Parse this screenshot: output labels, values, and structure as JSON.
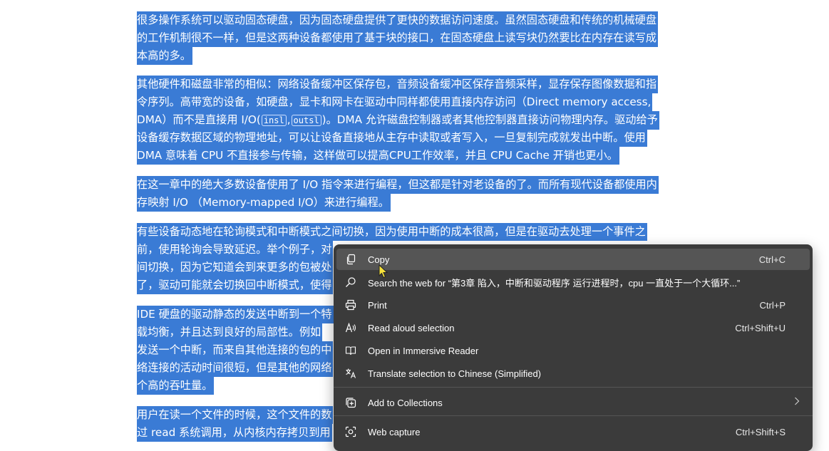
{
  "paragraphs": [
    {
      "lines": [
        [
          "很多操作系统可以驱动固态硬盘，因为固态硬盘提供了更快的数据访问速度。虽然固态硬盘和传统的机械硬盘"
        ],
        [
          "的工作机制很不一样，但是这两种设备都使用了基于块的接口，在固态硬盘上读写块仍然要比在内存在读写成"
        ],
        [
          "本高的多。"
        ]
      ]
    },
    {
      "lines": [
        [
          "其他硬件和磁盘非常的相似：网络设备缓冲区保存包，音频设备缓冲区保存音频采样，显存保存图像数据和指"
        ],
        [
          "令序列。高带宽的设备，如硬盘，显卡和网卡在驱动中同样都使用直接内存访问（Direct memory access,"
        ],
        [
          "DMA）而不是直接用 I/O(",
          "insl",
          ",",
          "outsl",
          ")。DMA 允许磁盘控制器或者其他控制器直接访问物理内存。驱动给予"
        ],
        [
          "设备缓存数据区域的物理地址，可以让设备直接地从主存中读取或者写入，一旦复制完成就发出中断。使用"
        ],
        [
          "DMA 意味着 CPU 不直接参与传输，这样做可以提高CPU工作效率，并且 CPU Cache 开销也更小。"
        ]
      ]
    },
    {
      "lines": [
        [
          "在这一章中的绝大多数设备使用了 I/O 指令来进行编程，但这都是针对老设备的了。而所有现代设备都使用内"
        ],
        [
          "存映射 I/O （Memory-mapped I/O）来进行编程。"
        ]
      ]
    },
    {
      "lines": [
        [
          "有些设备动态地在轮询模式和中断模式之间切换，因为使用中断的成本很高，但是在驱动去处理一个事件之"
        ],
        [
          "前，使用轮询会导致延迟。举个例子，对"
        ],
        [
          "间切换，因为它知道会到来更多的包被处"
        ],
        [
          "了，驱动可能就会切换回中断模式，使得"
        ]
      ]
    },
    {
      "lines": [
        [
          "IDE 硬盘的驱动静态的发送中断到一个特"
        ],
        [
          "载均衡，并且达到良好的局部性。例如"
        ],
        [
          "发送一个中断，而来自其他连接的包的中"
        ],
        [
          "络连接的活动时间很短，但是其他的网络"
        ],
        [
          "个高的吞吐量。"
        ]
      ]
    },
    {
      "lines": [
        [
          "用户在读一个文件的时候，这个文件的数"
        ],
        [
          "过 read 系统调用，从内核内存拷贝到用"
        ]
      ]
    }
  ],
  "context_menu": {
    "items": [
      {
        "label": "Copy",
        "shortcut": "Ctrl+C",
        "icon": "copy-icon",
        "highlighted": true
      },
      {
        "label": "Search the web for “第3章 陷入，中断和驱动程序 运行进程时，cpu 一直处于一个大循环...”",
        "shortcut": "",
        "icon": "search-icon"
      },
      {
        "label": "Print",
        "shortcut": "Ctrl+P",
        "icon": "printer-icon"
      },
      {
        "label": "Read aloud selection",
        "shortcut": "Ctrl+Shift+U",
        "icon": "read-aloud-icon"
      },
      {
        "label": "Open in Immersive Reader",
        "shortcut": "",
        "icon": "immersive-reader-icon"
      },
      {
        "label": "Translate selection to Chinese (Simplified)",
        "shortcut": "",
        "icon": "translate-icon"
      },
      {
        "label": "Add to Collections",
        "shortcut": "",
        "icon": "collections-icon",
        "submenu": true
      },
      {
        "label": "Web capture",
        "shortcut": "Ctrl+Shift+S",
        "icon": "web-capture-icon"
      }
    ]
  },
  "colors": {
    "selection": "#3a7bd5",
    "menu_bg": "#3b3b3b",
    "menu_highlight": "#555555"
  }
}
